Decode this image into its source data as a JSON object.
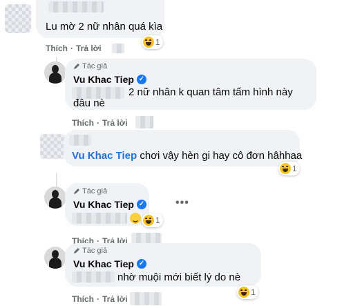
{
  "author_badge": "Tác giả",
  "author_name": "Vu Khac Tiep",
  "like_label": "Thích",
  "reply_label": "Trả lời",
  "separator": "·",
  "colors": {
    "bubble": "#f0f2f5",
    "verified": "#1877f2",
    "meta": "#65676b"
  },
  "comments": [
    {
      "text": "Lu mờ 2 nữ nhân quá kìa",
      "reaction_icon": "haha-icon",
      "reaction_count": "1"
    },
    {
      "text_line1": "2 nữ nhân k quan tâm tấm hình này",
      "text_line2": "đâu nè"
    },
    {
      "name": "Vu Khac Tiep",
      "text": "chơi vậy hèn gi hay cô đơn hâhhaa",
      "reaction_icon": "haha-icon",
      "reaction_count": "1"
    },
    {
      "reaction_icon": "haha-icon",
      "reaction_count": "1",
      "more_icon": "more-icon"
    },
    {
      "text": "nhờ muội mới biết lý do nè",
      "reaction_icon": "haha-icon",
      "reaction_count": "1"
    }
  ]
}
